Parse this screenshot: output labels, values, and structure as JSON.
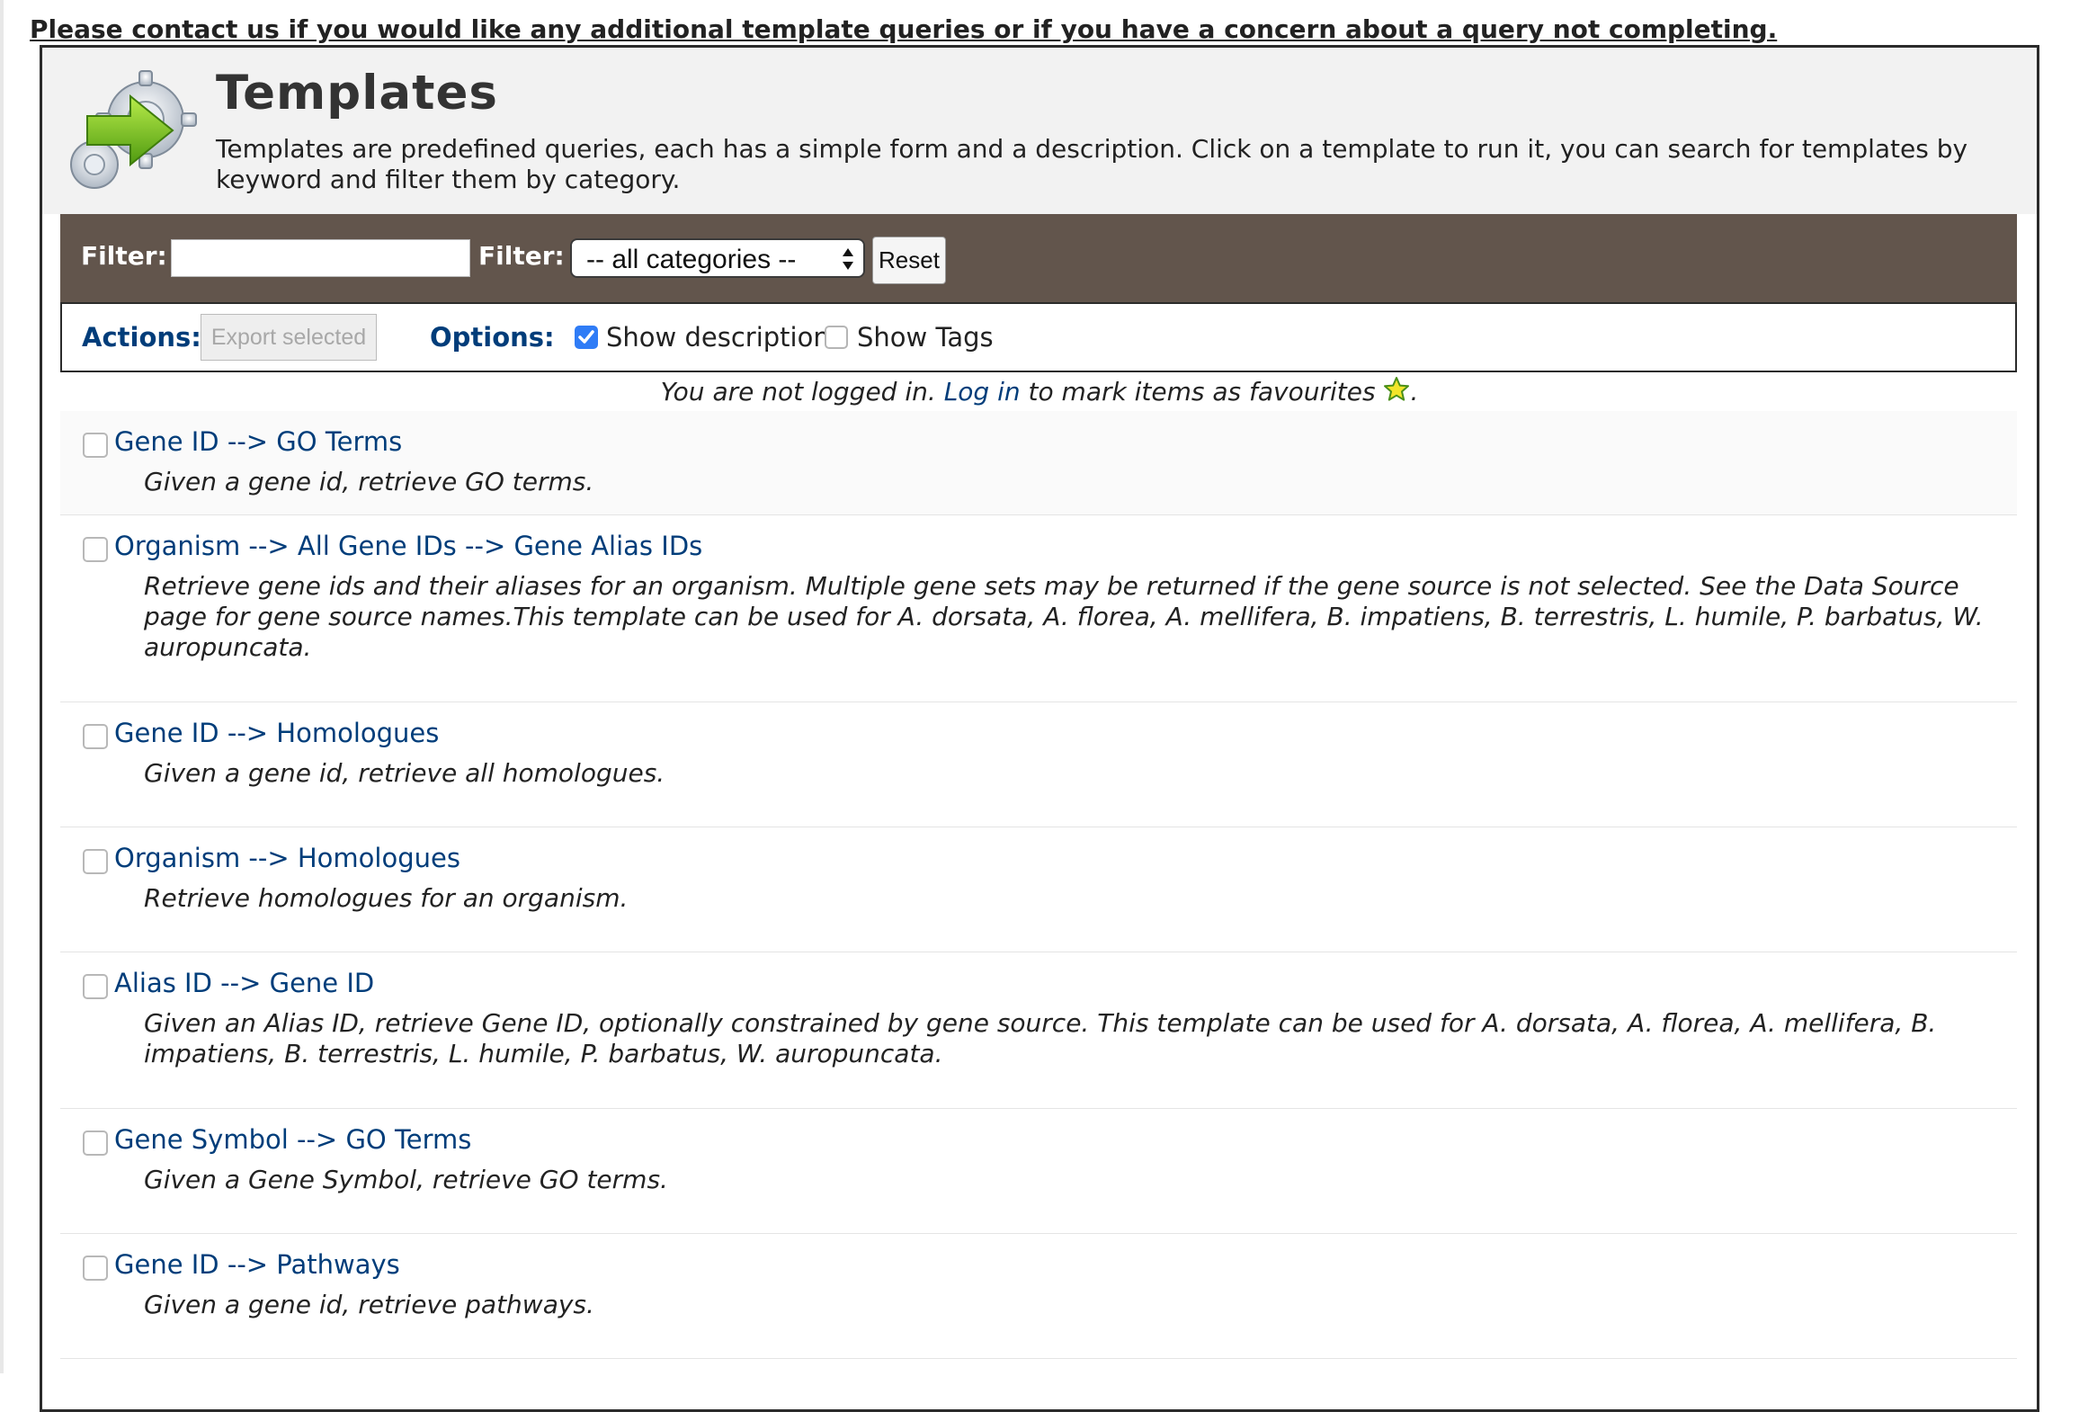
{
  "notice": "Please contact us if you would like any additional template queries or if you have a concern about a query not completing.",
  "header": {
    "title": "Templates",
    "description": "Templates are predefined queries, each has a simple form and a description. Click on a template to run it, you can search for templates by keyword and filter them by category."
  },
  "filters": {
    "keyword_label": "Filter:",
    "keyword_value": "",
    "category_label": "Filter:",
    "category_value": "-- all categories --",
    "reset_label": "Reset"
  },
  "actions": {
    "label": "Actions:",
    "export_label": "Export selected",
    "options_label": "Options:",
    "show_descriptions_label": "Show descriptions",
    "show_descriptions_checked": true,
    "show_tags_label": "Show Tags",
    "show_tags_checked": false
  },
  "login_note": {
    "prefix": "You are not logged in.",
    "link": "Log in",
    "suffix": "to mark items as favourites",
    "end": "."
  },
  "templates": [
    {
      "title": "Gene ID --> GO Terms",
      "description": "Given a gene id, retrieve GO terms."
    },
    {
      "title": "Organism --> All Gene IDs --> Gene Alias IDs",
      "description": "Retrieve gene ids and their aliases for an organism. Multiple gene sets may be returned if the gene source is not selected. See the Data Source page for gene source names.This template can be used for A. dorsata, A. florea, A. mellifera, B. impatiens, B. terrestris, L. humile, P. barbatus, W. auropuncata."
    },
    {
      "title": "Gene ID --> Homologues",
      "description": "Given a gene id, retrieve all homologues."
    },
    {
      "title": "Organism --> Homologues",
      "description": "Retrieve homologues for an organism."
    },
    {
      "title": "Alias ID --> Gene ID",
      "description": "Given an Alias ID, retrieve Gene ID, optionally constrained by gene source. This template can be used for A. dorsata, A. florea, A. mellifera, B. impatiens, B. terrestris, L. humile, P. barbatus, W. auropuncata."
    },
    {
      "title": "Gene Symbol --> GO Terms",
      "description": "Given a Gene Symbol, retrieve GO terms."
    },
    {
      "title": "Gene ID --> Pathways",
      "description": "Given a gene id, retrieve pathways."
    }
  ],
  "colors": {
    "filter_bar": "#62554c",
    "link": "#003d7a",
    "checkbox_checked": "#2f7cf6",
    "header_bg": "#f2f2f2"
  },
  "icons": {
    "logo": "templates-gear-arrow-icon",
    "favourite": "star-icon",
    "select_arrows": "updown-icon",
    "checkbox": "checkmark-icon"
  }
}
